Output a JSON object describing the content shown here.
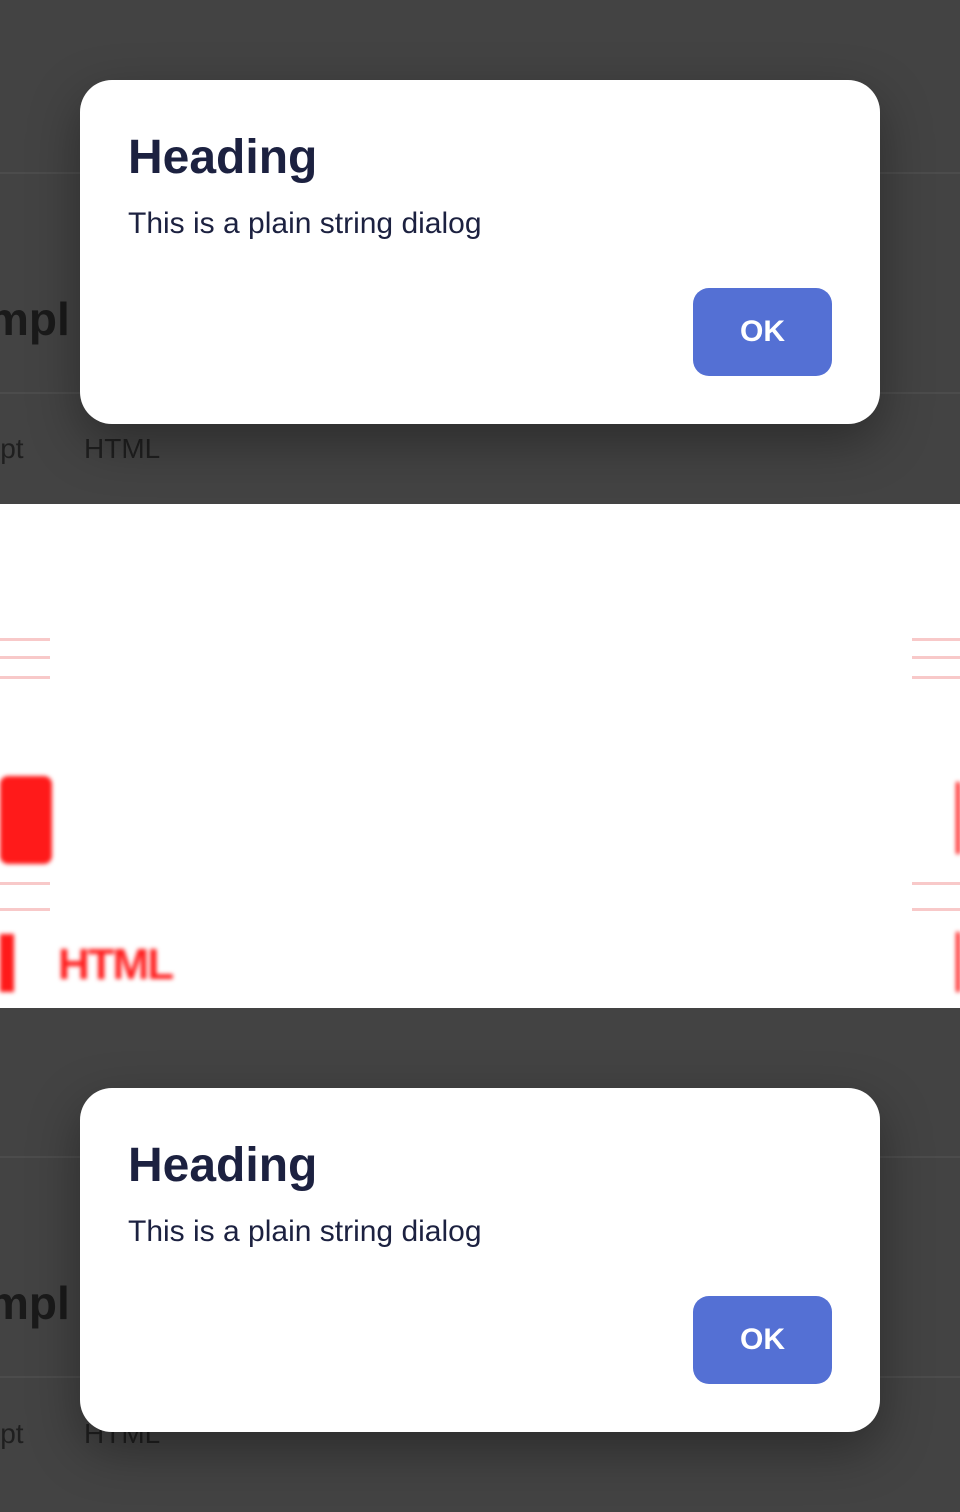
{
  "screens": [
    {
      "background": {
        "heading_fragment": "mpl",
        "tab_left_fragment": "ipt",
        "tab_html": "HTML"
      },
      "dialog": {
        "title": "Heading",
        "message": "This is a plain string dialog",
        "ok_label": "OK"
      }
    },
    {
      "background": {
        "heading_fragment": "mpl",
        "tab_left_fragment": "ipt",
        "tab_html": "HTML"
      },
      "dialog": {
        "title": "Heading",
        "message": "This is a plain string dialog",
        "ok_label": "OK"
      }
    }
  ],
  "artifact": {
    "blurred_text": "HTML"
  },
  "colors": {
    "backdrop": "#434343",
    "dialog_background": "#ffffff",
    "text": "#1c2140",
    "button": "#5470d4",
    "button_text": "#ffffff",
    "artifact_red": "#ff1a1a"
  }
}
